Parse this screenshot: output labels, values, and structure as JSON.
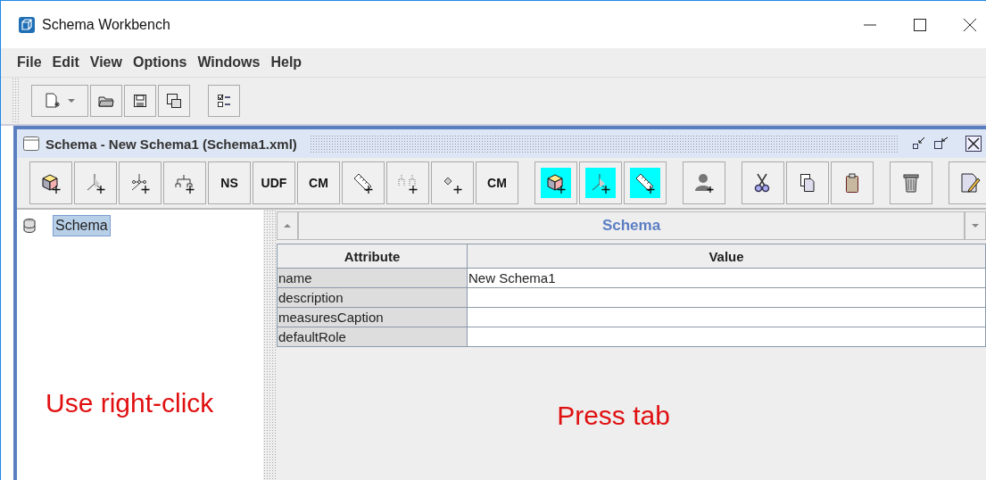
{
  "window": {
    "title": "Schema Workbench"
  },
  "menu": [
    "File",
    "Edit",
    "View",
    "Options",
    "Windows",
    "Help"
  ],
  "toolbar": [
    {
      "kind": "new"
    },
    {
      "kind": "open"
    },
    {
      "kind": "save"
    },
    {
      "kind": "save-as"
    },
    {
      "kind": "checklist"
    }
  ],
  "internal_frame": {
    "title": "Schema - New Schema1 (Schema1.xml)",
    "tools": [
      {
        "kind": "cube",
        "highlighted": false
      },
      {
        "kind": "axes",
        "highlighted": false
      },
      {
        "kind": "hier-axes",
        "highlighted": false
      },
      {
        "kind": "tree",
        "highlighted": false
      },
      {
        "kind": "text",
        "label": "NS",
        "highlighted": false
      },
      {
        "kind": "text",
        "label": "UDF",
        "highlighted": false
      },
      {
        "kind": "text",
        "label": "CM",
        "highlighted": false
      },
      {
        "kind": "ruler",
        "highlighted": false
      },
      {
        "kind": "dotted-tree",
        "highlighted": false
      },
      {
        "kind": "diamond",
        "highlighted": false
      },
      {
        "kind": "text-diamond",
        "label": "CM",
        "highlighted": false
      },
      {
        "kind": "gap"
      },
      {
        "kind": "cube",
        "highlighted": true
      },
      {
        "kind": "axes",
        "highlighted": true
      },
      {
        "kind": "ruler",
        "highlighted": true
      },
      {
        "kind": "gap"
      },
      {
        "kind": "person",
        "highlighted": false
      },
      {
        "kind": "gap"
      },
      {
        "kind": "scissors",
        "highlighted": false
      },
      {
        "kind": "copy",
        "highlighted": false
      },
      {
        "kind": "paste",
        "highlighted": false
      },
      {
        "kind": "gap"
      },
      {
        "kind": "trash",
        "highlighted": false
      },
      {
        "kind": "gap"
      },
      {
        "kind": "edit",
        "highlighted": false
      }
    ],
    "tree": [
      {
        "label": "Schema",
        "selected": true
      }
    ],
    "element_selector": {
      "value": "Schema"
    },
    "table": {
      "columns": [
        "Attribute",
        "Value"
      ],
      "rows": [
        [
          "name",
          "New Schema1"
        ],
        [
          "description",
          ""
        ],
        [
          "measuresCaption",
          ""
        ],
        [
          "defaultRole",
          ""
        ]
      ]
    }
  },
  "annotations": [
    {
      "text": "Use right-click"
    },
    {
      "text": "Press tab"
    }
  ]
}
